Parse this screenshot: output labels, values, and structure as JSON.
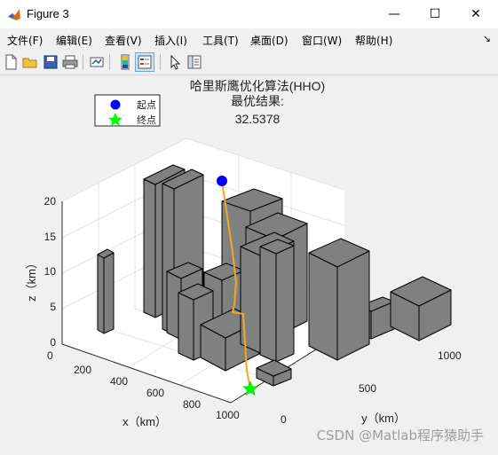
{
  "window": {
    "title": "Figure 3"
  },
  "controls": {
    "minimize": "—",
    "maximize": "☐",
    "close": "✕"
  },
  "menu": [
    "文件(F)",
    "编辑(E)",
    "查看(V)",
    "插入(I)",
    "工具(T)",
    "桌面(D)",
    "窗口(W)",
    "帮助(H)"
  ],
  "toolbar_icons": [
    "new-figure-icon",
    "open-file-icon",
    "save-icon",
    "print-icon",
    "link-plot-icon",
    "colorbar-icon",
    "legend-icon",
    "pointer-icon",
    "property-editor-icon"
  ],
  "plot": {
    "title_lines": [
      "哈里斯鹰优化算法(HHO)",
      "最优结果:",
      "32.5378"
    ],
    "legend": [
      "起点",
      "终点"
    ],
    "zlabel": "z（km）",
    "xlabel": "x（km）",
    "ylabel": "y（km）",
    "z_ticks": [
      "0",
      "5",
      "10",
      "15",
      "20"
    ],
    "x_ticks": [
      "0",
      "200",
      "400",
      "600",
      "800",
      "1000"
    ],
    "y_ticks": [
      "0",
      "500",
      "1000"
    ]
  },
  "chart_data": {
    "type": "scatter",
    "title": "哈里斯鹰优化算法(HHO)",
    "subtitle": "最优结果: 32.5378",
    "xlabel": "x（km）",
    "ylabel": "y（km）",
    "zlabel": "z（km）",
    "xlim": [
      0,
      1100
    ],
    "ylim": [
      0,
      1100
    ],
    "zlim": [
      0,
      20
    ],
    "grid": true,
    "legend_position": "top-left",
    "series": [
      {
        "name": "起点",
        "marker": "circle",
        "color": "#0000ff"
      },
      {
        "name": "终点",
        "marker": "pentagram",
        "color": "#00ff00"
      }
    ],
    "path_color": "#f5a623",
    "obstacle_color": "#808080"
  },
  "watermark": "CSDN @Matlab程序猿助手"
}
